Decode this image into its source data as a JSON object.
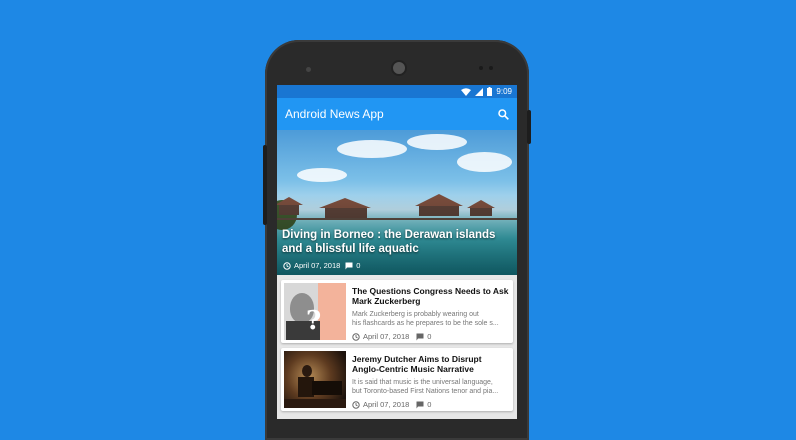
{
  "statusbar": {
    "time": "9:09"
  },
  "appbar": {
    "title": "Android News App",
    "search_icon": "search-icon"
  },
  "hero": {
    "title": "Diving in Borneo : the Derawan islands and a blissful life aquatic",
    "date": "April 07, 2018",
    "comments": "0"
  },
  "articles": [
    {
      "title": "The Questions Congress Needs to Ask Mark Zuckerberg",
      "desc_line1": "Mark Zuckerberg is probably wearing out",
      "desc_line2": "his flashcards as he prepares to be the sole s...",
      "date": "April 07, 2018",
      "comments": "0"
    },
    {
      "title": "Jeremy Dutcher Aims to Disrupt Anglo-Centric Music Narrative",
      "desc_line1": "It is said that music is the universal language,",
      "desc_line2": "but Toronto-based First Nations tenor and pia...",
      "date": "April 07, 2018",
      "comments": "0"
    }
  ],
  "colors": {
    "background": "#1e88e5",
    "statusbar": "#1976d2",
    "appbar": "#2196f3"
  }
}
